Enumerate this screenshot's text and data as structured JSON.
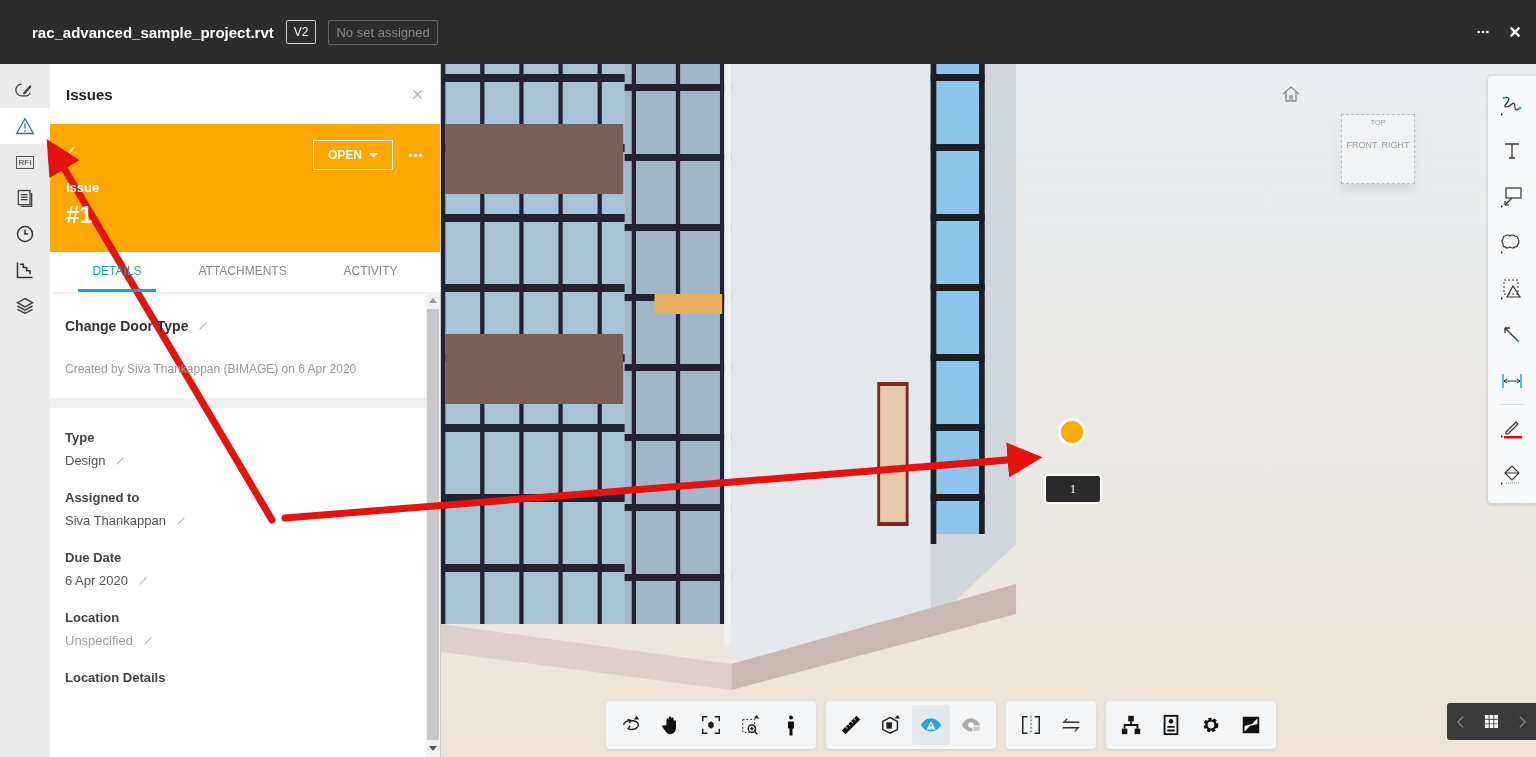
{
  "file": {
    "name": "rac_advanced_sample_project.rvt",
    "version": "V2",
    "set": "No set assigned"
  },
  "rail": [
    {
      "kind": "markup",
      "selected": false
    },
    {
      "kind": "issues",
      "selected": true
    },
    {
      "kind": "rfi",
      "label": "RFI",
      "selected": false
    },
    {
      "kind": "sheets",
      "selected": false
    },
    {
      "kind": "history",
      "selected": false
    },
    {
      "kind": "steps",
      "selected": false
    },
    {
      "kind": "layers",
      "selected": false
    }
  ],
  "panel": {
    "title": "Issues",
    "status": "OPEN",
    "issue_label": "Issue",
    "issue_number": "#1",
    "tabs": [
      {
        "label": "DETAILS",
        "selected": true
      },
      {
        "label": "ATTACHMENTS",
        "selected": false
      },
      {
        "label": "ACTIVITY",
        "selected": false
      }
    ],
    "issue_title": "Change Door Type",
    "created": "Created by Siva Thankappan (BIMAGE) on 6 Apr 2020",
    "fields": [
      {
        "label": "Type",
        "value": "Design",
        "specified": true
      },
      {
        "label": "Assigned to",
        "value": "Siva Thankappan",
        "specified": true
      },
      {
        "label": "Due Date",
        "value": "6 Apr 2020",
        "specified": true
      },
      {
        "label": "Location",
        "value": "Unspecified",
        "specified": false
      },
      {
        "label": "Location Details"
      }
    ]
  },
  "view_cube": {
    "top": "TOP",
    "front": "FRONT",
    "right": "RIGHT"
  },
  "pin": {
    "label": "1"
  },
  "toolbar": [
    [
      {
        "kind": "orbit",
        "selected": false
      },
      {
        "kind": "pan",
        "selected": false
      },
      {
        "kind": "fit",
        "selected": false
      },
      {
        "kind": "zoom-window",
        "selected": false
      },
      {
        "kind": "walk",
        "selected": false
      }
    ],
    [
      {
        "kind": "measure",
        "selected": false
      },
      {
        "kind": "section",
        "selected": false
      },
      {
        "kind": "clash-eye",
        "selected": true
      },
      {
        "kind": "ghost-eye",
        "selected": false
      }
    ],
    [
      {
        "kind": "split",
        "selected": false
      },
      {
        "kind": "swap",
        "selected": false
      }
    ],
    [
      {
        "kind": "tree",
        "selected": false
      },
      {
        "kind": "properties",
        "selected": false
      },
      {
        "kind": "settings",
        "selected": false
      },
      {
        "kind": "fullscreen",
        "selected": false
      }
    ]
  ],
  "markup_tools": [
    {
      "kind": "freehand"
    },
    {
      "kind": "text"
    },
    {
      "kind": "callout"
    },
    {
      "kind": "cloud"
    },
    {
      "kind": "shape"
    },
    {
      "kind": "arrow"
    },
    {
      "kind": "dimension"
    },
    {
      "kind": "pen"
    },
    {
      "kind": "fill"
    }
  ]
}
